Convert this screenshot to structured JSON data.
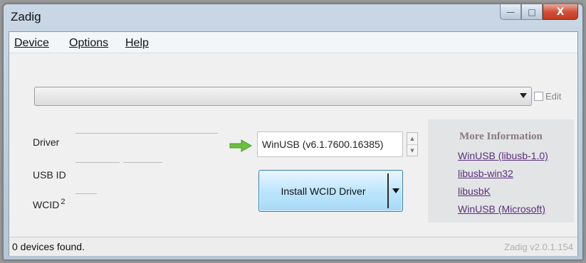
{
  "window": {
    "title": "Zadig",
    "buttons": {
      "minimize": "—",
      "maximize": "□",
      "close": "X"
    }
  },
  "menu": {
    "items": [
      {
        "label": "Device"
      },
      {
        "label": "Options"
      },
      {
        "label": "Help"
      }
    ]
  },
  "device_select": {
    "value": "",
    "edit_label": "Edit",
    "edit_checked": false
  },
  "labels": {
    "driver": "Driver",
    "usb_id": "USB ID",
    "wcid": "WCID",
    "wcid_sup": "2"
  },
  "target_driver": {
    "value": "WinUSB (v6.1.7600.16385)",
    "arrow_color": "#6bbf3f"
  },
  "install_button": {
    "label": "Install WCID Driver"
  },
  "more_info": {
    "heading": "More Information",
    "links": [
      {
        "label": "WinUSB (libusb-1.0)"
      },
      {
        "label": "libusb-win32"
      },
      {
        "label": "libusbK"
      },
      {
        "label": "WinUSB (Microsoft)"
      }
    ]
  },
  "status": {
    "text": "0 devices found.",
    "version": "Zadig v2.0.1.154"
  },
  "colors": {
    "accent": "#3c7fb1",
    "link": "#5b2f7c",
    "close_button": "#c23a22"
  }
}
